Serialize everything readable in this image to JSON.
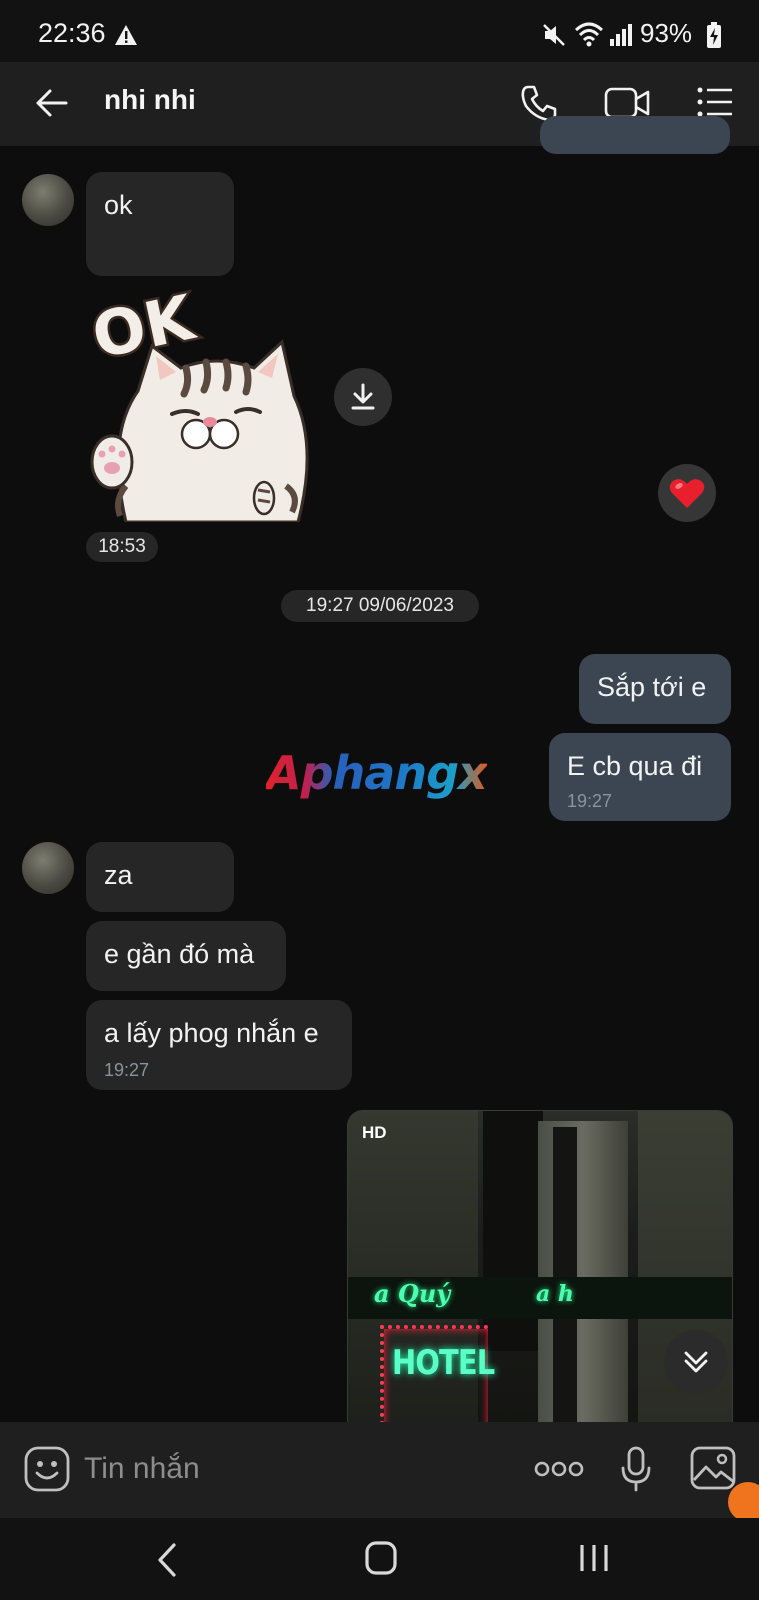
{
  "status_bar": {
    "time": "22:36",
    "battery": "93%",
    "icons": [
      "warning-icon",
      "mute-icon",
      "wifi-icon",
      "signal-icon",
      "battery-charging-icon"
    ]
  },
  "header": {
    "back_icon": "arrow-left-icon",
    "contact_name": "nhi nhi",
    "actions": [
      "phone-icon",
      "video-call-icon",
      "menu-list-icon"
    ]
  },
  "messages": {
    "m1": {
      "text": "ok"
    },
    "sticker": {
      "text": "OK",
      "time": "18:53"
    },
    "date_separator": "19:27 09/06/2023",
    "out1": {
      "text": "Sắp tới e"
    },
    "out2": {
      "text": "E cb qua đi",
      "time": "19:27"
    },
    "watermark": "Aphangx",
    "in2": {
      "text": "za"
    },
    "in3": {
      "text": "e gần đó mà"
    },
    "in4": {
      "text": "a lấy phog nhắn e",
      "time": "19:27"
    },
    "photo": {
      "badge": "HD",
      "sign_text": "HOTEL",
      "neon_text_1": "a Quý",
      "neon_text_2": "a h"
    }
  },
  "composer": {
    "placeholder": "Tin nhắn",
    "icons": [
      "emoji-icon",
      "more-dots-icon",
      "microphone-icon",
      "gallery-icon"
    ]
  },
  "colors": {
    "background": "#0d0d0d",
    "incoming_bubble": "#262626",
    "outgoing_bubble": "#3b4652",
    "header": "#1f1f1f",
    "reaction_heart": "#e8202e"
  }
}
